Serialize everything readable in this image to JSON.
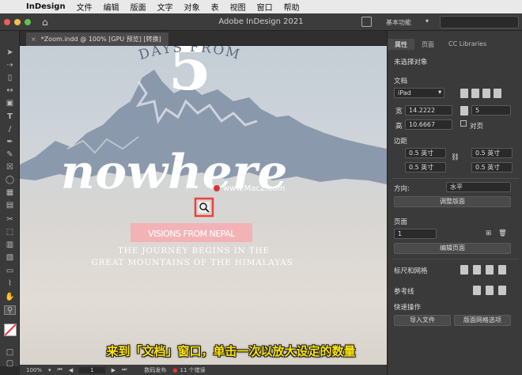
{
  "menubar": {
    "app_name": "InDesign",
    "items": [
      "文件",
      "编辑",
      "版面",
      "文字",
      "对象",
      "表",
      "视图",
      "窗口",
      "帮助"
    ]
  },
  "app": {
    "title": "Adobe InDesign 2021",
    "workspace": "基本功能"
  },
  "document": {
    "tab_label": "*Zoom.indd @ 100% [GPU 预览] [转换]"
  },
  "artwork": {
    "number": "5",
    "arc_text": "DAYS FROM",
    "headline": "nowhere",
    "badge_text": "VISIONS FROM NEPAL",
    "tagline_line1": "THE JOURNEY BEGINS IN THE",
    "tagline_line2": "GREAT MOUNTAINS OF THE HIMALAYAS",
    "watermark": "www.MacZ.com"
  },
  "status": {
    "zoom": "100%",
    "page": "1",
    "preflight_profile": "数码发布",
    "errors": "11 个错误"
  },
  "properties_panel": {
    "tabs": [
      "属性",
      "页面",
      "CC Libraries"
    ],
    "no_selection": "未选择对象",
    "document_section": "文档",
    "preset": "iPad",
    "width_label": "宽",
    "width_value": "14.2222",
    "height_label": "高",
    "height_value": "10.6667",
    "pages_value": "5",
    "facing_pages": "对页",
    "margins_section": "边距",
    "margin_top": "0.5 英寸",
    "margin_bottom": "0.5 英寸",
    "margin_left": "0.5 英寸",
    "margin_right": "0.5 英寸",
    "orientation_label": "方向:",
    "orientation_value": "水平",
    "adjust_layout": "调整版面",
    "page_section": "页面",
    "page_value": "1",
    "edit_page": "编辑页面",
    "rulers_grids": "标尺和网格",
    "guides": "参考线",
    "quick_actions": "快速操作",
    "import_file": "导入文件",
    "layout_grid_options": "版面网格选项"
  },
  "caption": "来到「文档」窗口，单击一次以放大设定的数量",
  "colors": {
    "accent_red": "#e8443a",
    "caption_yellow": "#ffe600",
    "badge_pink": "#f3b3b6"
  }
}
